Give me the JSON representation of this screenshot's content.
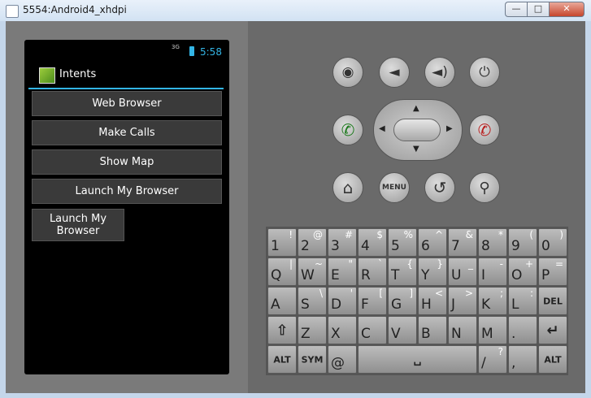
{
  "window": {
    "title": "5554:Android4_xhdpi"
  },
  "statusbar": {
    "signal": "3G",
    "time": "5:58"
  },
  "app": {
    "title": "Intents"
  },
  "buttons": [
    {
      "label": "Web Browser"
    },
    {
      "label": "Make Calls"
    },
    {
      "label": "Show Map"
    },
    {
      "label": "Launch My Browser"
    },
    {
      "label": "Launch My Browser"
    }
  ],
  "controls": {
    "menu_label": "MENU"
  },
  "keyboard": {
    "row1": [
      {
        "main": "1",
        "alt": "!"
      },
      {
        "main": "2",
        "alt": "@"
      },
      {
        "main": "3",
        "alt": "#"
      },
      {
        "main": "4",
        "alt": "$"
      },
      {
        "main": "5",
        "alt": "%"
      },
      {
        "main": "6",
        "alt": "^"
      },
      {
        "main": "7",
        "alt": "&"
      },
      {
        "main": "8",
        "alt": "*"
      },
      {
        "main": "9",
        "alt": "("
      },
      {
        "main": "0",
        "alt": ")"
      }
    ],
    "row2": [
      {
        "main": "Q",
        "alt": "|"
      },
      {
        "main": "W",
        "alt": "~"
      },
      {
        "main": "E",
        "alt": "\""
      },
      {
        "main": "R",
        "alt": "`"
      },
      {
        "main": "T",
        "alt": "{"
      },
      {
        "main": "Y",
        "alt": "}"
      },
      {
        "main": "U",
        "alt": "_"
      },
      {
        "main": "I",
        "alt": "-"
      },
      {
        "main": "O",
        "alt": "+"
      },
      {
        "main": "P",
        "alt": "="
      }
    ],
    "row3": [
      {
        "main": "A",
        "alt": ""
      },
      {
        "main": "S",
        "alt": "\\"
      },
      {
        "main": "D",
        "alt": "'"
      },
      {
        "main": "F",
        "alt": "["
      },
      {
        "main": "G",
        "alt": "]"
      },
      {
        "main": "H",
        "alt": "<"
      },
      {
        "main": "J",
        "alt": ">"
      },
      {
        "main": "K",
        "alt": ";"
      },
      {
        "main": "L",
        "alt": ":"
      }
    ],
    "row4": [
      {
        "main": "Z",
        "alt": ""
      },
      {
        "main": "X",
        "alt": ""
      },
      {
        "main": "C",
        "alt": ""
      },
      {
        "main": "V",
        "alt": ""
      },
      {
        "main": "B",
        "alt": ""
      },
      {
        "main": "N",
        "alt": ""
      },
      {
        "main": "M",
        "alt": ""
      },
      {
        "main": ".",
        "alt": ""
      }
    ],
    "del_label": "DEL",
    "alt_label": "ALT",
    "sym_label": "SYM",
    "at_label": "@",
    "slash": {
      "main": "/",
      "alt": "?"
    },
    "comma": {
      "main": ",",
      "alt": ""
    }
  }
}
